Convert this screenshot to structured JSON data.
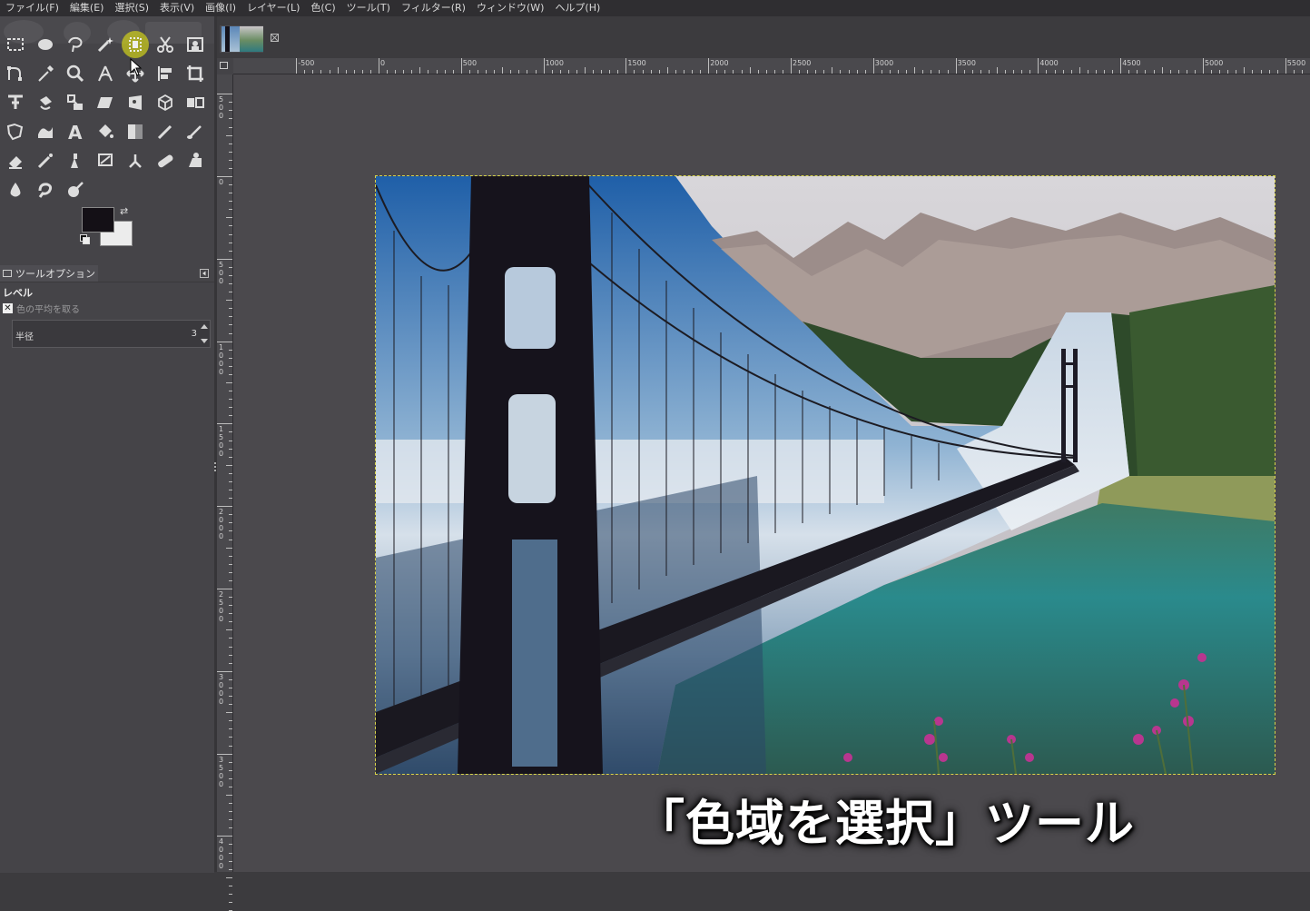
{
  "menubar": {
    "items": [
      "ファイル(F)",
      "編集(E)",
      "選択(S)",
      "表示(V)",
      "画像(I)",
      "レイヤー(L)",
      "色(C)",
      "ツール(T)",
      "フィルター(R)",
      "ウィンドウ(W)",
      "ヘルプ(H)"
    ]
  },
  "toolbox": {
    "tools": [
      "rect-select-icon",
      "ellipse-select-icon",
      "free-select-icon",
      "fuzzy-select-icon",
      "select-by-color-icon",
      "scissors-select-icon",
      "foreground-select-icon",
      "paths-icon",
      "color-picker-icon",
      "zoom-icon",
      "measure-icon",
      "move-icon",
      "align-icon",
      "crop-icon",
      "unified-transform-icon",
      "rotate-icon",
      "scale-icon",
      "shear-icon",
      "perspective-icon",
      "3d-transform-icon",
      "flip-icon",
      "cage-transform-icon",
      "warp-transform-icon",
      "text-icon",
      "bucket-fill-icon",
      "gradient-icon",
      "pencil-icon",
      "paintbrush-icon",
      "eraser-icon",
      "airbrush-icon",
      "ink-icon",
      "mypaint-brush-icon",
      "clone-icon",
      "heal-icon",
      "perspective-clone-icon",
      "blur-icon",
      "smudge-icon",
      "dodge-burn-icon"
    ],
    "active_tool": "select-by-color-icon",
    "foreground_color": "#141016",
    "background_color": "#ececec"
  },
  "tool_options": {
    "tab_label": "ツールオプション",
    "title": "レベル",
    "checkbox_label": "色の平均を取る",
    "checkbox_checked": true,
    "radius_label": "半径",
    "radius_value": "3"
  },
  "rulers": {
    "horizontal_labels": [
      "-500",
      "0",
      "500",
      "1000",
      "1500",
      "2000",
      "2500",
      "3000",
      "3500",
      "4000",
      "4500",
      "5000",
      "5500"
    ],
    "vertical_labels": [
      "500",
      "0",
      "500",
      "1000",
      "1500",
      "2000",
      "2500",
      "3000",
      "3500",
      "4000"
    ]
  },
  "canvas": {
    "caption": "「色域を選択」ツール"
  }
}
